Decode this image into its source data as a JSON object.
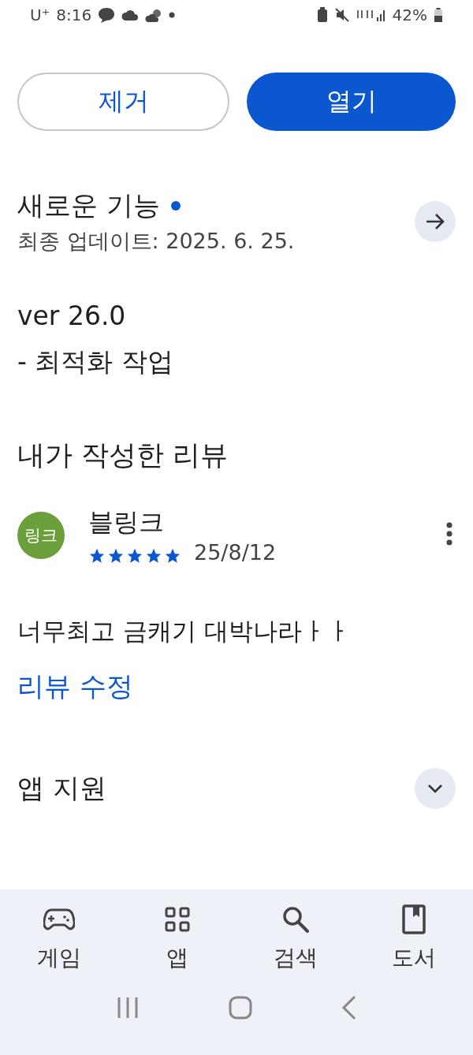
{
  "status_bar": {
    "carrier": "U⁺",
    "time": "8:16",
    "battery": "42%"
  },
  "buttons": [
    {
      "label": "제거",
      "kind": "outlined"
    },
    {
      "label": "열기",
      "kind": "filled"
    }
  ],
  "whats_new": {
    "title": "새로운 기능",
    "new_dot": true,
    "updated": "최종 업데이트: 2025. 6. 25.",
    "lines": [
      "ver 26.0",
      "- 최적화 작업"
    ]
  },
  "my_review": {
    "title": "내가 작성한 리뷰",
    "avatar_text": "링크",
    "author": "블링크",
    "stars": 5,
    "date": "25/8/12",
    "text": "너무최고 금캐기 대박나라ㅏㅏ",
    "edit_link": "리뷰 수정"
  },
  "sections": [
    {
      "title": "앱 지원",
      "expanded": false
    }
  ],
  "bottom_nav": [
    {
      "label": "게임",
      "selected": false
    },
    {
      "label": "앱",
      "selected": false
    },
    {
      "label": "검색",
      "selected": false
    },
    {
      "label": "도서",
      "selected": false
    }
  ]
}
